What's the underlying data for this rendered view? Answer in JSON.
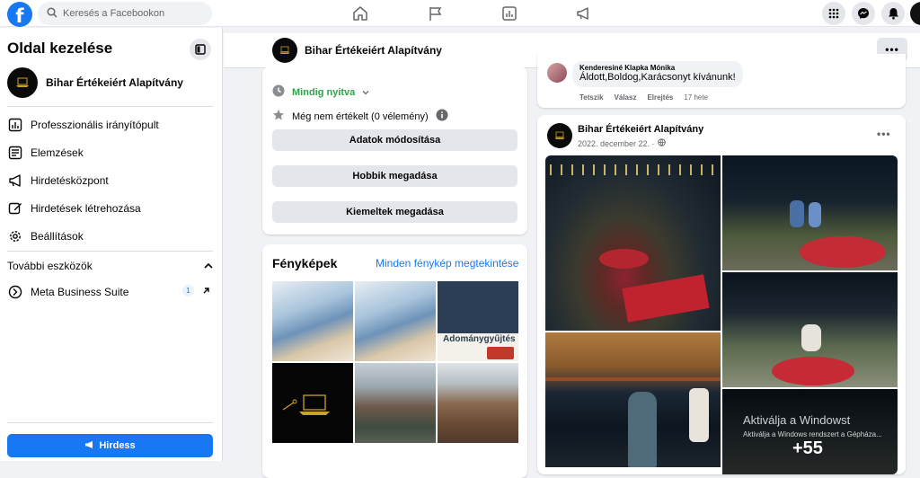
{
  "topbar": {
    "search_placeholder": "Keresés a Facebookon",
    "logo": "f",
    "nav_icons": [
      "home-icon",
      "flag-icon",
      "chart-icon",
      "megaphone-icon"
    ],
    "right_icons": [
      "grid-menu-icon",
      "messenger-icon",
      "bell-icon",
      "profile-avatar"
    ]
  },
  "sidebar": {
    "title": "Oldal kezelése",
    "page_name": "Bihar Értékeiért Alapítvány",
    "items": [
      {
        "label": "Professzionális irányítópult",
        "icon": "dashboard-icon"
      },
      {
        "label": "Elemzések",
        "icon": "insights-icon"
      },
      {
        "label": "Hirdetésközpont",
        "icon": "megaphone-icon"
      },
      {
        "label": "Hirdetések létrehozása",
        "icon": "edit-icon"
      },
      {
        "label": "Beállítások",
        "icon": "gear-icon"
      }
    ],
    "section_title": "További eszközök",
    "meta_label": "Meta Business Suite",
    "meta_badge": "1",
    "cta_label": "Hirdess"
  },
  "page_header": {
    "name": "Bihar Értékeiért Alapítvány",
    "more": "•••"
  },
  "about": {
    "open_status": "Mindig nyitva",
    "rating": "Még nem értékelt (0 vélemény)",
    "buttons": [
      "Adatok módosítása",
      "Hobbik megadása",
      "Kiemeltek megadása"
    ]
  },
  "photos": {
    "title": "Fényképek",
    "see_all": "Minden fénykép megtekintése",
    "poster_text": "Adománygyűjtés"
  },
  "comment": {
    "author": "Kenderesiné Klapka Mónika",
    "text": "Áldott,Boldog,Karácsonyt kívánunk!",
    "actions": [
      "Tetszik",
      "Válasz",
      "Elrejtés"
    ],
    "time": "17 hete"
  },
  "post": {
    "author": "Bihar Értékeiért Alapítvány",
    "date": "2022. december 22. ·",
    "more": "•••",
    "more_photos": "+55"
  },
  "watermark": {
    "title": "Aktiválja a Windowst",
    "subtitle": "Aktiválja a Windows rendszert a Gépháza..."
  },
  "colors": {
    "brand": "#1877f2",
    "open_green": "#31a24c",
    "background": "#f0f2f5"
  }
}
